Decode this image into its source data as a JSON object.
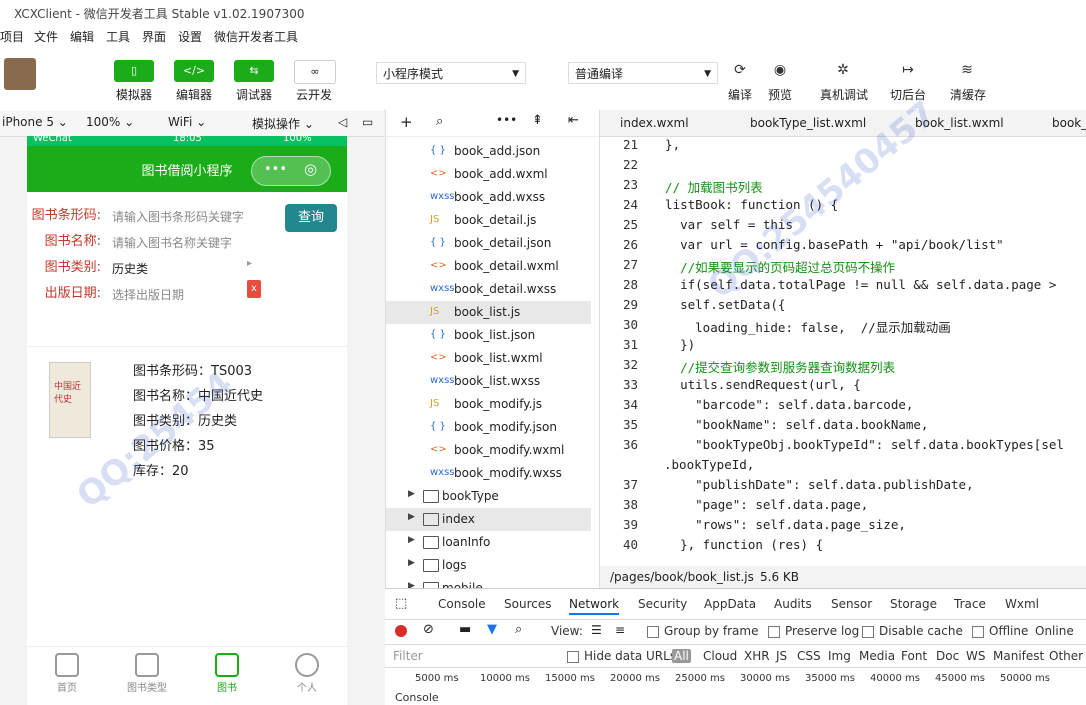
{
  "window": {
    "title": "XCXClient - 微信开发者工具 Stable v1.02.1907300"
  },
  "menu": [
    "项目",
    "文件",
    "编辑",
    "工具",
    "界面",
    "设置",
    "微信开发者工具"
  ],
  "toolbar": {
    "simulator": "模拟器",
    "editor": "编辑器",
    "debugger": "调试器",
    "cloud": "云开发",
    "mode_select": "小程序模式",
    "compile_select": "普通编译",
    "compile": "编译",
    "preview": "预览",
    "remote_debug": "真机调试",
    "background": "切后台",
    "clear_cache": "清缓存"
  },
  "simbar": {
    "device": "iPhone 5",
    "zoom": "100%",
    "network": "WiFi",
    "operation": "模拟操作"
  },
  "phone": {
    "status_carrier": "WeChat",
    "status_time": "18:05",
    "status_battery": "100%",
    "nav_title": "图书借阅小程序",
    "form": {
      "barcode_label": "图书条形码:",
      "barcode_placeholder": "请输入图书条形码关键字",
      "name_label": "图书名称:",
      "name_placeholder": "请输入图书名称关键字",
      "type_label": "图书类别:",
      "type_value": "历史类",
      "date_label": "出版日期:",
      "date_placeholder": "选择出版日期",
      "query_button": "查询",
      "clear_button": "x"
    },
    "book": {
      "barcode": "图书条形码：TS003",
      "name": "图书名称：中国近代史",
      "type": "图书类别：历史类",
      "price": "图书价格：35",
      "stock": "库存：20",
      "cover_title": "中国近代史"
    },
    "tabs": [
      "首页",
      "图书类型",
      "图书",
      "个人"
    ]
  },
  "files": [
    {
      "icon": "{ }",
      "name": "book_add.json",
      "color": "#1e73c8"
    },
    {
      "icon": "<>",
      "name": "book_add.wxml",
      "color": "#e0662e"
    },
    {
      "icon": "wxss",
      "name": "book_add.wxss",
      "color": "#2d6bd1"
    },
    {
      "icon": "JS",
      "name": "book_detail.js",
      "color": "#d4a12b"
    },
    {
      "icon": "{ }",
      "name": "book_detail.json",
      "color": "#1e73c8"
    },
    {
      "icon": "<>",
      "name": "book_detail.wxml",
      "color": "#e0662e"
    },
    {
      "icon": "wxss",
      "name": "book_detail.wxss",
      "color": "#2d6bd1"
    },
    {
      "icon": "JS",
      "name": "book_list.js",
      "color": "#d4a12b"
    },
    {
      "icon": "{ }",
      "name": "book_list.json",
      "color": "#1e73c8"
    },
    {
      "icon": "<>",
      "name": "book_list.wxml",
      "color": "#e0662e"
    },
    {
      "icon": "wxss",
      "name": "book_list.wxss",
      "color": "#2d6bd1"
    },
    {
      "icon": "JS",
      "name": "book_modify.js",
      "color": "#d4a12b"
    },
    {
      "icon": "{ }",
      "name": "book_modify.json",
      "color": "#1e73c8"
    },
    {
      "icon": "<>",
      "name": "book_modify.wxml",
      "color": "#e0662e"
    },
    {
      "icon": "wxss",
      "name": "book_modify.wxss",
      "color": "#2d6bd1"
    }
  ],
  "folders": [
    "bookType",
    "index",
    "loanInfo",
    "logs",
    "mobile"
  ],
  "editor_tabs": [
    "index.wxml",
    "bookType_list.wxml",
    "book_list.wxml",
    "book_"
  ],
  "code": [
    {
      "n": "21",
      "t": "  },",
      "c": "plain"
    },
    {
      "n": "22",
      "t": "",
      "c": "plain"
    },
    {
      "n": "23",
      "t": "  // 加载图书列表",
      "c": "cm"
    },
    {
      "n": "24",
      "t": "  listBook: function () {",
      "c": "plain"
    },
    {
      "n": "25",
      "t": "    var self = this",
      "c": "plain"
    },
    {
      "n": "26",
      "t": "    var url = config.basePath + \"api/book/list\"",
      "c": "plain"
    },
    {
      "n": "27",
      "t": "    //如果要显示的页码超过总页码不操作",
      "c": "cm"
    },
    {
      "n": "28",
      "t": "    if(self.data.totalPage != null && self.data.page >",
      "c": "plain"
    },
    {
      "n": "29",
      "t": "    self.setData({",
      "c": "plain"
    },
    {
      "n": "30",
      "t": "      loading_hide: false,  //显示加载动画",
      "c": "plain"
    },
    {
      "n": "31",
      "t": "    })",
      "c": "plain"
    },
    {
      "n": "32",
      "t": "    //提交查询参数到服务器查询数据列表",
      "c": "cm"
    },
    {
      "n": "33",
      "t": "    utils.sendRequest(url, {",
      "c": "plain"
    },
    {
      "n": "34",
      "t": "      \"barcode\": self.data.barcode,",
      "c": "plain"
    },
    {
      "n": "35",
      "t": "      \"bookName\": self.data.bookName,",
      "c": "plain"
    },
    {
      "n": "36",
      "t": "      \"bookTypeObj.bookTypeId\": self.data.bookTypes[sel",
      "c": "plain"
    },
    {
      "n": "",
      "t": ".bookTypeId,",
      "c": "wrap"
    },
    {
      "n": "37",
      "t": "      \"publishDate\": self.data.publishDate,",
      "c": "plain"
    },
    {
      "n": "38",
      "t": "      \"page\": self.data.page,",
      "c": "plain"
    },
    {
      "n": "39",
      "t": "      \"rows\": self.data.page_size,",
      "c": "plain"
    },
    {
      "n": "40",
      "t": "    }, function (res) {",
      "c": "plain"
    }
  ],
  "editor_status": {
    "path": "/pages/book/book_list.js",
    "size": "5.6 KB"
  },
  "devtools": {
    "tabs": [
      "Console",
      "Sources",
      "Network",
      "Security",
      "AppData",
      "Audits",
      "Sensor",
      "Storage",
      "Trace",
      "Wxml"
    ],
    "active_tab": "Network",
    "view_label": "View:",
    "group_by_frame": "Group by frame",
    "preserve_log": "Preserve log",
    "disable_cache": "Disable cache",
    "offline": "Offline",
    "online": "Online",
    "filter_placeholder": "Filter",
    "hide_data_urls": "Hide data URLs",
    "filters": [
      "All",
      "Cloud",
      "XHR",
      "JS",
      "CSS",
      "Img",
      "Media",
      "Font",
      "Doc",
      "WS",
      "Manifest",
      "Other"
    ],
    "ticks": [
      "5000 ms",
      "10000 ms",
      "15000 ms",
      "20000 ms",
      "25000 ms",
      "30000 ms",
      "35000 ms",
      "40000 ms",
      "45000 ms",
      "50000 ms"
    ],
    "console_label": "Console"
  },
  "colors": {
    "green": "#1aad19",
    "teal": "#23878e",
    "red_label": "#c0392b"
  }
}
